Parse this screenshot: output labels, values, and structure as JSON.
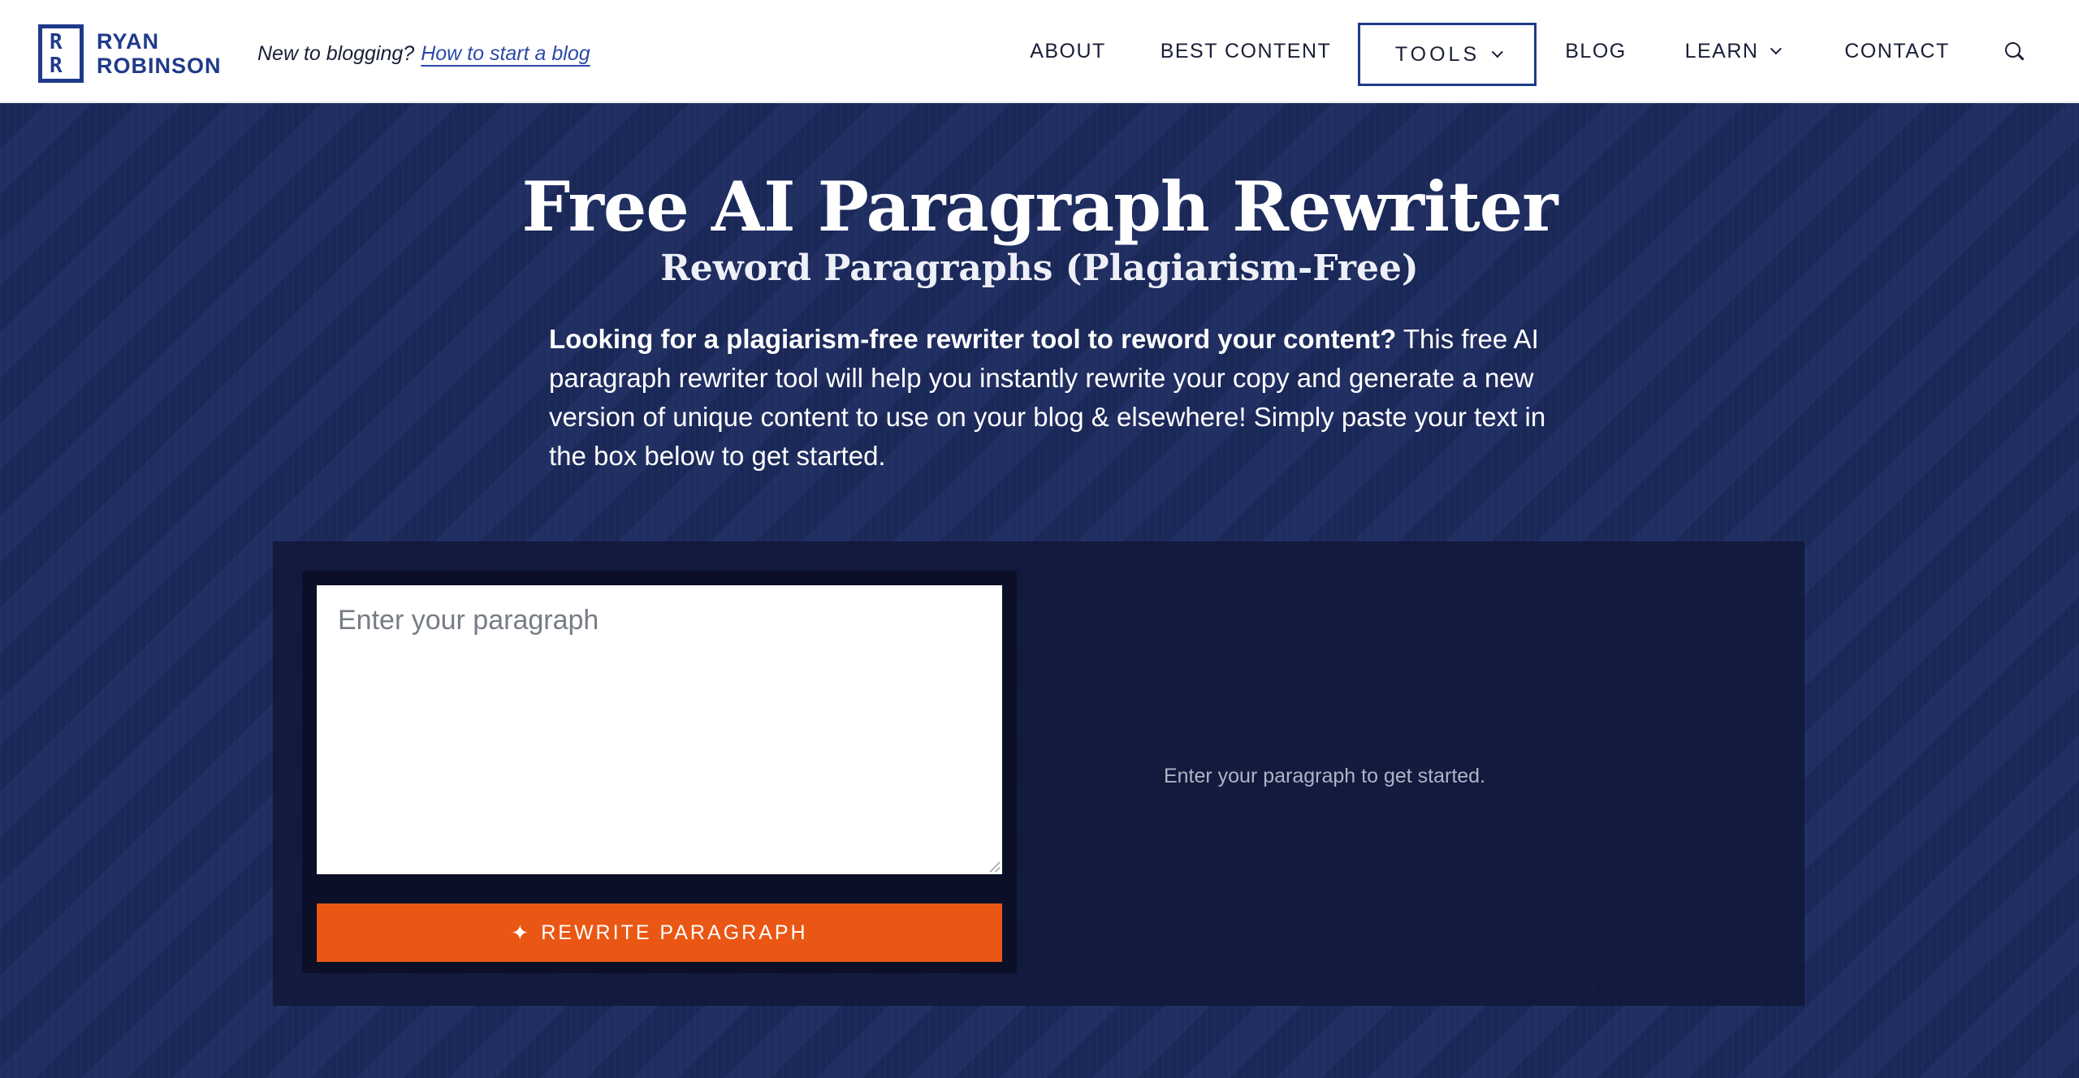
{
  "header": {
    "logo": {
      "line1": "RYAN",
      "line2": "ROBINSON",
      "mark_top": "R",
      "mark_bottom": "R"
    },
    "tagline": {
      "text": "New to blogging?",
      "link": "How to start a blog"
    },
    "nav": {
      "about": "ABOUT",
      "best_content": "BEST CONTENT",
      "tools": "TOOLS",
      "blog": "BLOG",
      "learn": "LEARN",
      "contact": "CONTACT"
    }
  },
  "hero": {
    "title": "Free AI Paragraph Rewriter",
    "subtitle": "Reword Paragraphs (Plagiarism-Free)",
    "desc_bold": "Looking for a plagiarism-free rewriter tool to reword your content?",
    "desc_rest": " This free AI paragraph rewriter tool will help you instantly rewrite your copy and generate a new version of unique content to use on your blog & elsewhere! Simply paste your text in the box below to get started."
  },
  "tool": {
    "input_placeholder": "Enter your paragraph",
    "input_value": "",
    "button_label": "REWRITE PARAGRAPH",
    "button_icon": "sparkle-icon",
    "output_message": "Enter your paragraph to get started."
  },
  "colors": {
    "brand_blue": "#1e3a8a",
    "hero_bg": "#1c2a5e",
    "accent_orange": "#ea5714"
  }
}
